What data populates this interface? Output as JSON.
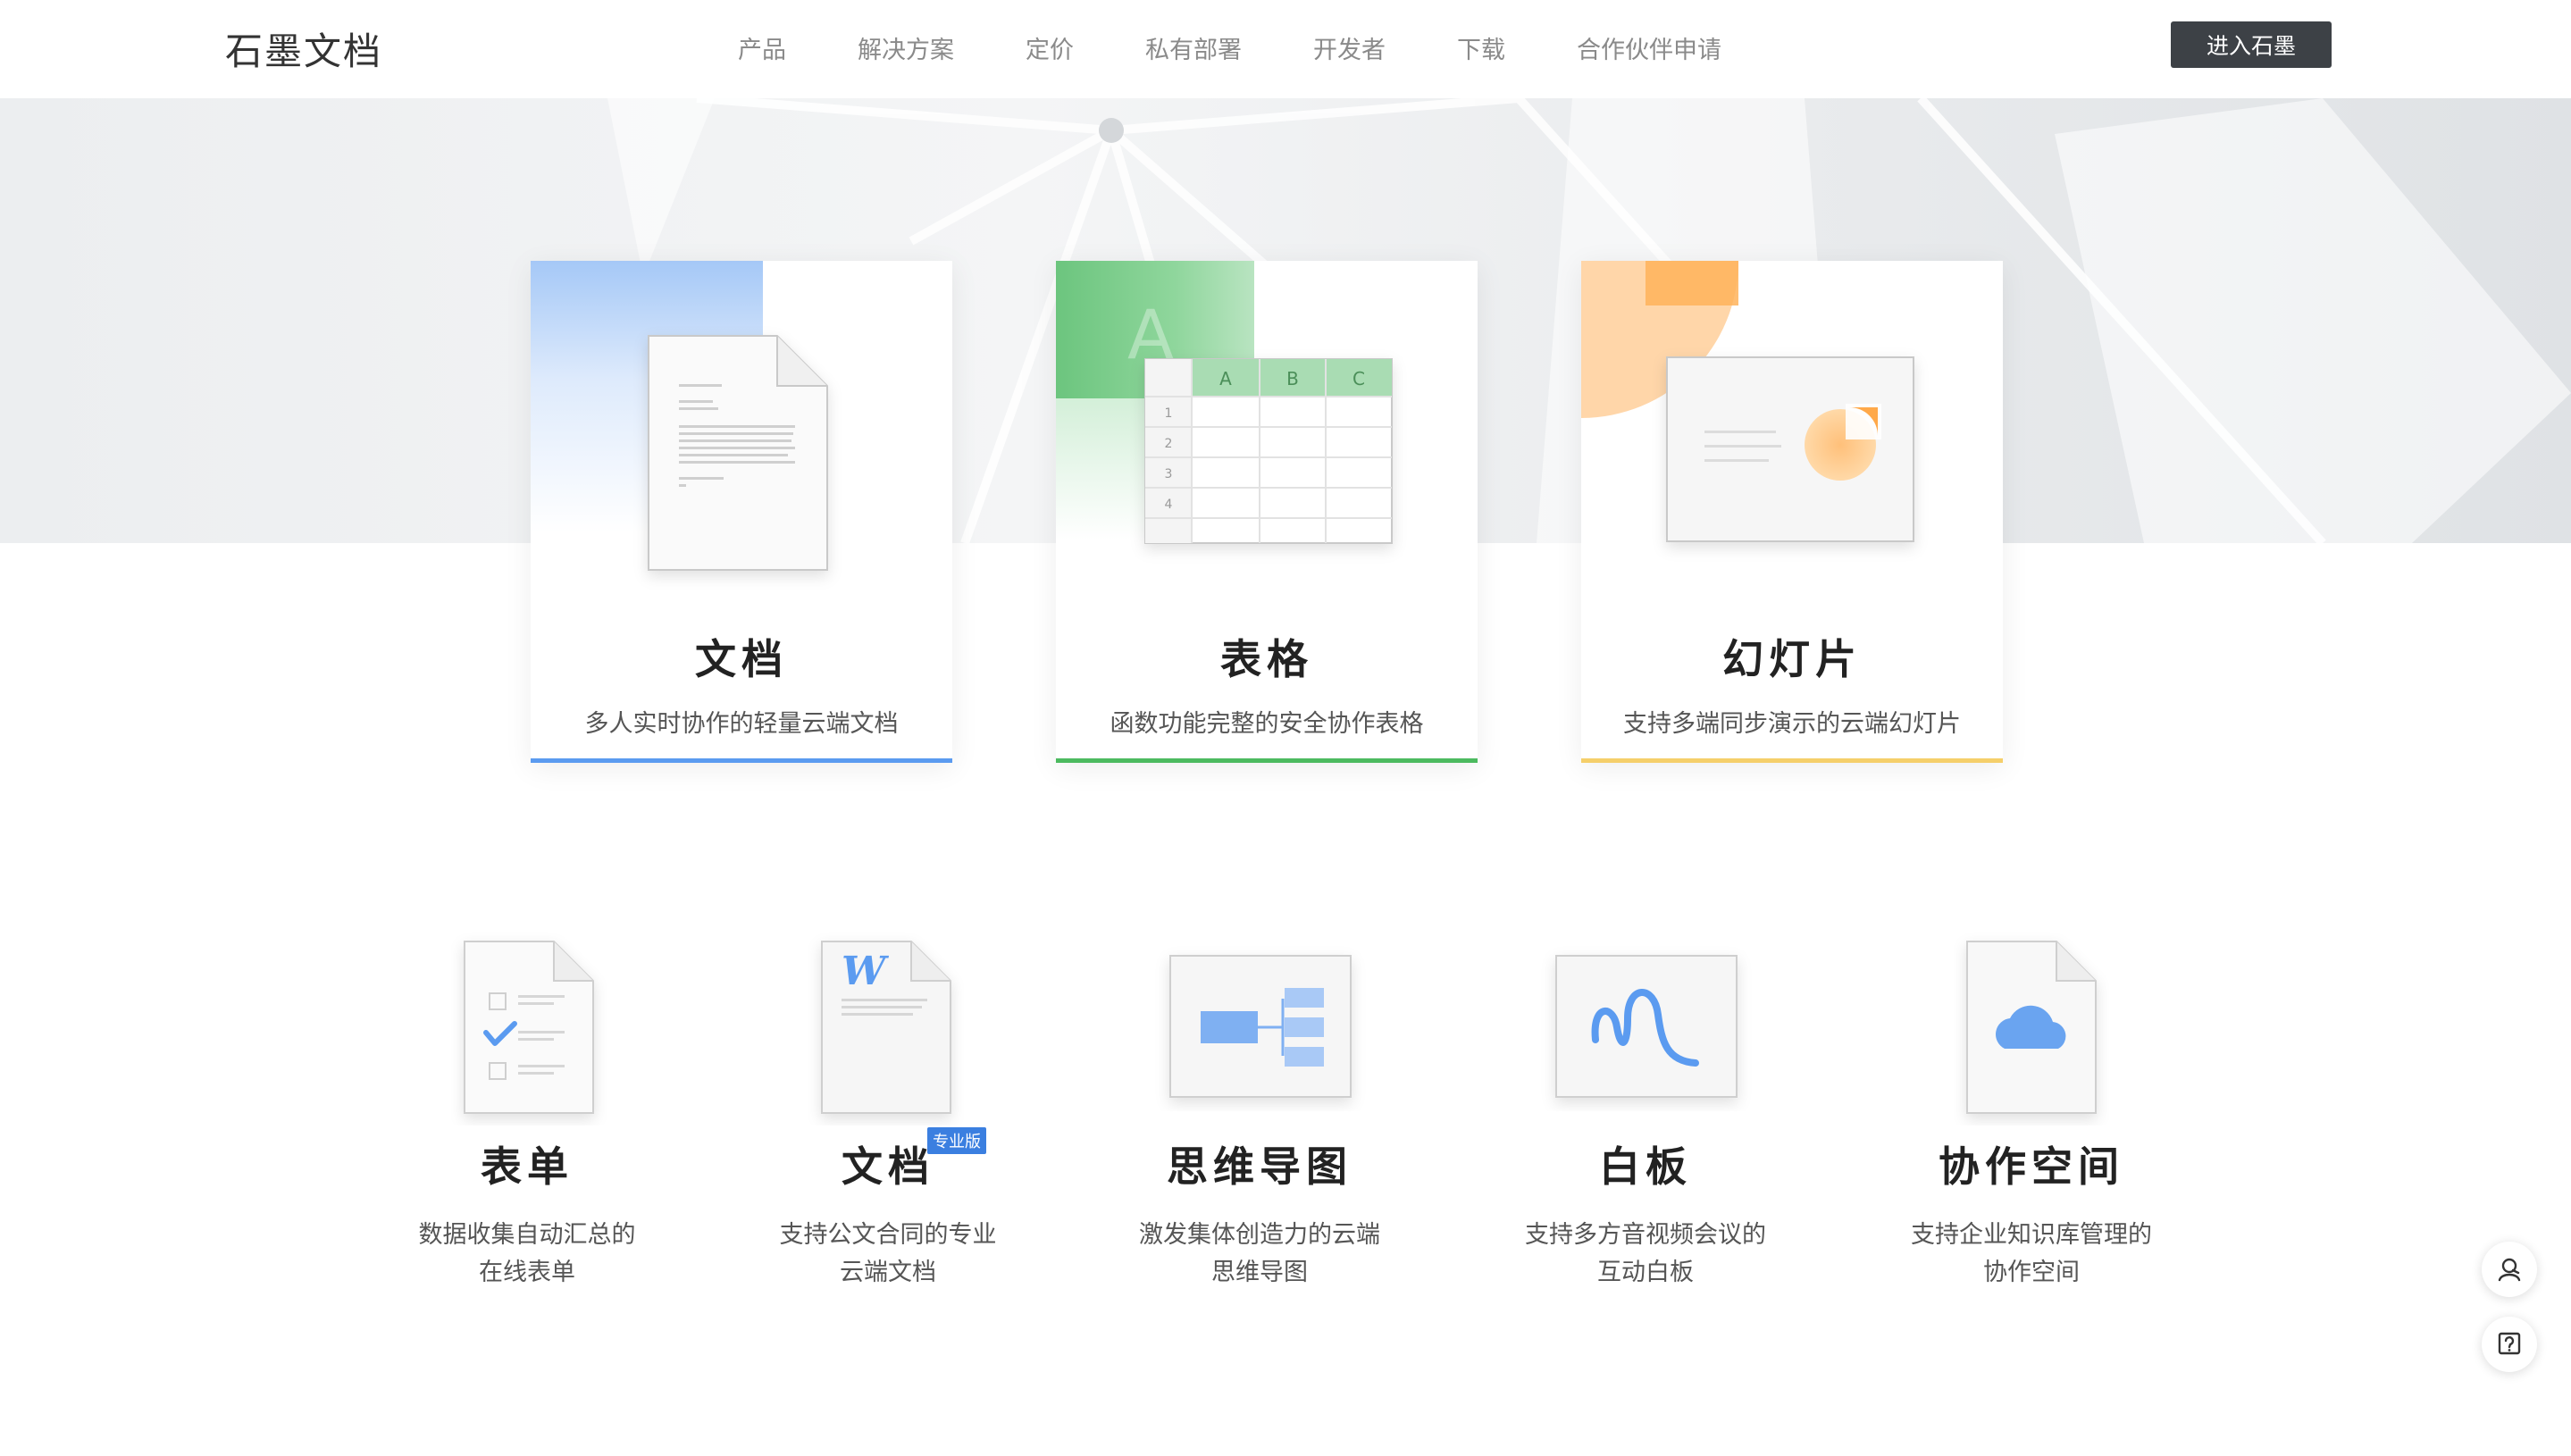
{
  "header": {
    "logo": "石墨文档",
    "nav": [
      "产品",
      "解决方案",
      "定价",
      "私有部署",
      "开发者",
      "下载",
      "合作伙伴申请"
    ],
    "enter_button": "进入石墨"
  },
  "cards": [
    {
      "title": "文档",
      "desc": "多人实时协作的轻量云端文档",
      "accent": "#5b9bf0"
    },
    {
      "title": "表格",
      "desc": "函数功能完整的安全协作表格",
      "accent": "#4cba5f"
    },
    {
      "title": "幻灯片",
      "desc": "支持多端同步演示的云端幻灯片",
      "accent": "#f5cf6a"
    }
  ],
  "sheet_columns": [
    "A",
    "B",
    "C"
  ],
  "sheet_rows": [
    "1",
    "2",
    "3",
    "4"
  ],
  "sheet_watermark": "A",
  "docx_letter": "W",
  "products": [
    {
      "title": "表单",
      "desc_line1": "数据收集自动汇总的",
      "desc_line2": "在线表单",
      "icon": "form-icon"
    },
    {
      "title": "文档",
      "badge": "专业版",
      "desc_line1": "支持公文合同的专业",
      "desc_line2": "云端文档",
      "icon": "word-document-icon"
    },
    {
      "title": "思维导图",
      "desc_line1": "激发集体创造力的云端",
      "desc_line2": "思维导图",
      "icon": "mindmap-icon"
    },
    {
      "title": "白板",
      "desc_line1": "支持多方音视频会议的",
      "desc_line2": "互动白板",
      "icon": "whiteboard-icon"
    },
    {
      "title": "协作空间",
      "desc_line1": "支持企业知识库管理的",
      "desc_line2": "协作空间",
      "icon": "cloud-space-icon"
    }
  ],
  "float_buttons": [
    "customer-service-icon",
    "help-icon"
  ]
}
